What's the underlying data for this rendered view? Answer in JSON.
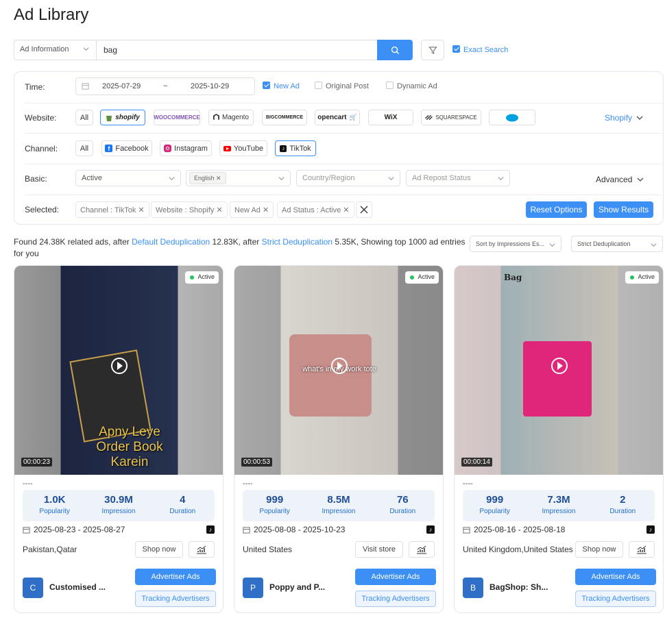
{
  "page": {
    "title": "Ad Library"
  },
  "search": {
    "type_label": "Ad Information",
    "query": "bag",
    "exact_label": "Exact Search",
    "exact_checked": true
  },
  "filters": {
    "time": {
      "label": "Time:",
      "start": "2025-07-29",
      "sep": "~",
      "end": "2025-10-29",
      "options": [
        {
          "label": "New Ad",
          "checked": true
        },
        {
          "label": "Original Post",
          "checked": false
        },
        {
          "label": "Dynamic Ad",
          "checked": false
        }
      ]
    },
    "website": {
      "label": "Website:",
      "all": "All",
      "items": [
        "shopify",
        "WOOCOMMERCE",
        "Magento",
        "BIGCOMMERCE",
        "opencart",
        "WiX",
        "SQUARESPACE",
        "salesforce"
      ],
      "selected": "Shopify"
    },
    "channel": {
      "label": "Channel:",
      "all": "All",
      "items": [
        "Facebook",
        "Instagram",
        "YouTube",
        "TikTok"
      ]
    },
    "basic": {
      "label": "Basic:",
      "status": "Active",
      "language_chip": "English",
      "country_placeholder": "Country/Region",
      "repost_placeholder": "Ad Repost Status",
      "advanced": "Advanced"
    },
    "selected": {
      "label": "Selected:",
      "tags": [
        "Channel : TikTok",
        "Website : Shopify",
        "New Ad",
        "Ad Status : Active"
      ],
      "reset": "Reset Options",
      "show": "Show Results"
    }
  },
  "results": {
    "found_prefix": "Found 24.38K related ads, after",
    "default_dedup": "Default Deduplication",
    "default_count": "12.83K,",
    "after_text": "after",
    "strict_dedup": "Strict Deduplication",
    "strict_suffix": "5.35K, Showing top 1000 ad entries for you",
    "sort": "Sort by Impressions Es...",
    "dedup_select": "Strict Deduplication"
  },
  "cards": [
    {
      "status": "Active",
      "duration_overlay": "00:00:23",
      "overlay_text1": "Apny Leye",
      "overlay_text2": "Order Book Karein",
      "title": "----",
      "popularity": "1.0K",
      "impression": "30.9M",
      "duration": "4",
      "popularity_label": "Popularity",
      "impression_label": "Impression",
      "duration_label": "Duration",
      "dates": "2025-08-23 - 2025-08-27",
      "country": "Pakistan,Qatar",
      "shop_button": "Shop now",
      "avatar": "C",
      "advertiser": "Customised ...",
      "adv_button": "Advertiser Ads",
      "track_button": "Tracking Advertisers"
    },
    {
      "status": "Active",
      "duration_overlay": "00:00:53",
      "overlay_text1": "what's in my work tote",
      "title": "----",
      "popularity": "999",
      "impression": "8.5M",
      "duration": "76",
      "popularity_label": "Popularity",
      "impression_label": "Impression",
      "duration_label": "Duration",
      "dates": "2025-08-08 - 2025-10-23",
      "country": "United States",
      "shop_button": "Visit store",
      "avatar": "P",
      "advertiser": "Poppy and P...",
      "adv_button": "Advertiser Ads",
      "track_button": "Tracking Advertisers"
    },
    {
      "status": "Active",
      "duration_overlay": "00:00:14",
      "overlay_text1": "Bag",
      "title": "----",
      "popularity": "999",
      "impression": "7.3M",
      "duration": "2",
      "popularity_label": "Popularity",
      "impression_label": "Impression",
      "duration_label": "Duration",
      "dates": "2025-08-16 - 2025-08-18",
      "country": "United Kingdom,United States",
      "shop_button": "Shop now",
      "avatar": "B",
      "advertiser": "BagShop: Sh...",
      "adv_button": "Advertiser Ads",
      "track_button": "Tracking Advertisers"
    }
  ]
}
